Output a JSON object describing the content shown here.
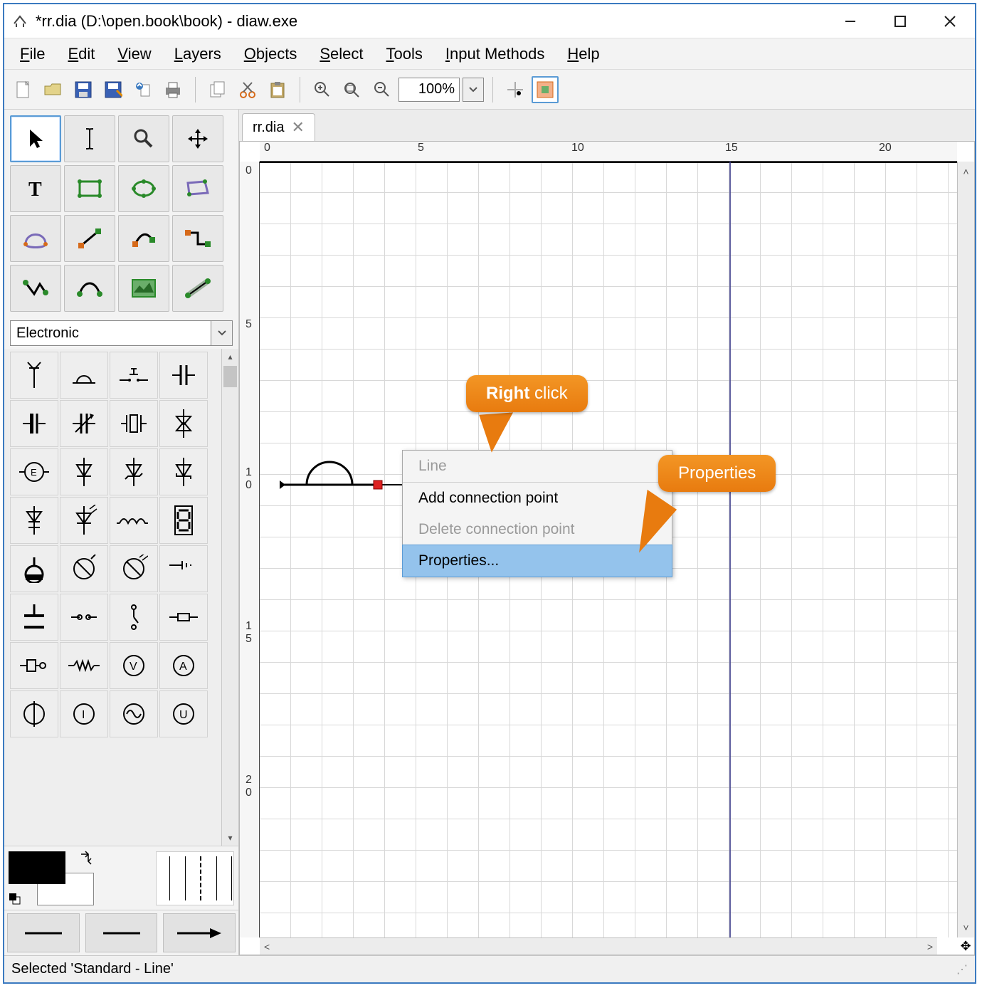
{
  "window": {
    "title": "*rr.dia (D:\\open.book\\book) - diaw.exe"
  },
  "menu": {
    "file": "File",
    "edit": "Edit",
    "view": "View",
    "layers": "Layers",
    "objects": "Objects",
    "select": "Select",
    "tools": "Tools",
    "input_methods": "Input Methods",
    "help": "Help"
  },
  "toolbar": {
    "zoom_value": "100%"
  },
  "shape_library": {
    "selected": "Electronic"
  },
  "tab": {
    "label": "rr.dia"
  },
  "ruler": {
    "h0": "0",
    "h5": "5",
    "h10": "10",
    "h15": "15",
    "h20": "20",
    "v0": "0",
    "v5": "5",
    "v10_a": "1",
    "v10_b": "0",
    "v15_a": "1",
    "v15_b": "5",
    "v20_a": "2",
    "v20_b": "0"
  },
  "context_menu": {
    "line": "Line",
    "add_point": "Add connection point",
    "delete_point": "Delete connection point",
    "properties": "Properties..."
  },
  "callouts": {
    "right_bold": "Right",
    "right_rest": " click",
    "properties": "Properties"
  },
  "status": {
    "text": "Selected 'Standard - Line'"
  }
}
